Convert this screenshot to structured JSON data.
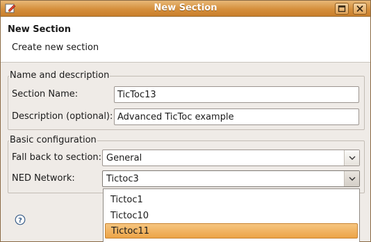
{
  "window": {
    "title": "New Section"
  },
  "header": {
    "title": "New Section",
    "subtitle": "Create new section"
  },
  "name_group": {
    "legend": "Name and description",
    "section_name_label": "Section Name:",
    "section_name_value": "TicToc13",
    "description_label": "Description (optional):",
    "description_value": "Advanced TicToc example"
  },
  "basic_group": {
    "legend": "Basic configuration",
    "fallback_label": "Fall back to section:",
    "fallback_value": "General",
    "ned_label": "NED Network:",
    "ned_value": "Tictoc3"
  },
  "dropdown": {
    "items": [
      {
        "label": "Tictoc1",
        "selected": false
      },
      {
        "label": "Tictoc10",
        "selected": false
      },
      {
        "label": "Tictoc11",
        "selected": true
      }
    ]
  },
  "colors": {
    "titlebar": "#d58f3c",
    "selection": "#eca447"
  },
  "icons": {
    "app": "edit-icon",
    "help": "help-icon"
  }
}
